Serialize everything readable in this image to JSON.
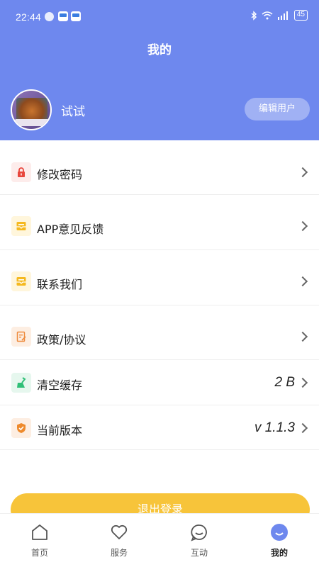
{
  "status_bar": {
    "time": "22:44",
    "battery": "45"
  },
  "header": {
    "title": "我的"
  },
  "profile": {
    "username": "试试",
    "edit_label": "编辑用户"
  },
  "menu": {
    "items": [
      {
        "label": "修改密码",
        "icon": "lock-icon"
      },
      {
        "label": "APP意见反馈",
        "icon": "feedback-icon"
      },
      {
        "label": "联系我们",
        "icon": "contact-icon"
      },
      {
        "label": "政策/协议",
        "icon": "policy-icon"
      },
      {
        "label": "清空缓存",
        "icon": "broom-icon",
        "value": "2 B"
      },
      {
        "label": "当前版本",
        "icon": "shield-icon",
        "value": "v 1.1.3"
      }
    ]
  },
  "logout_label": "退出登录",
  "tabbar": {
    "tabs": [
      {
        "label": "首页",
        "icon": "home-icon"
      },
      {
        "label": "服务",
        "icon": "heart-icon"
      },
      {
        "label": "互动",
        "icon": "chat-icon"
      },
      {
        "label": "我的",
        "icon": "profile-icon",
        "active": true
      }
    ]
  },
  "colors": {
    "header_bg": "#6e88ee",
    "logout_bg": "#f7c43a",
    "active_tab": "#6e88ee"
  }
}
